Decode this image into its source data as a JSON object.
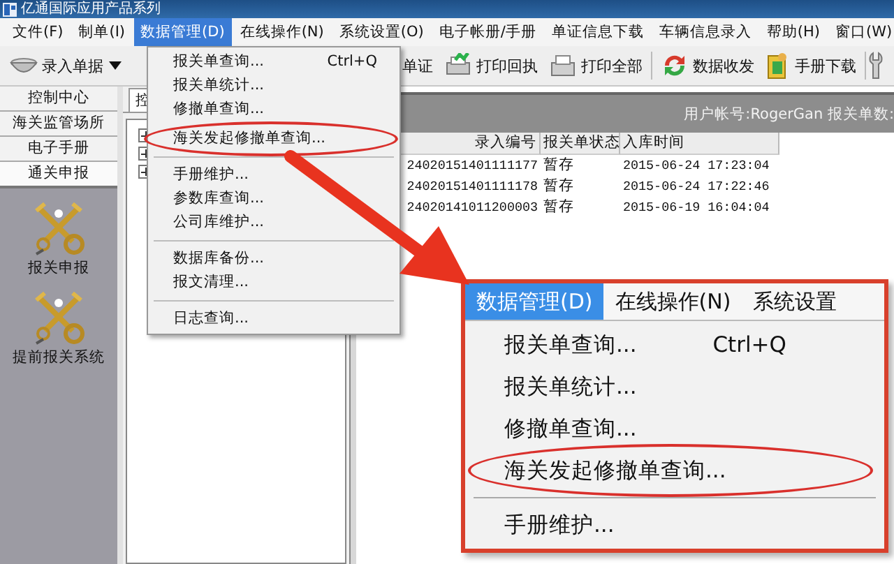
{
  "window": {
    "title": "亿通国际应用产品系列"
  },
  "menu_bar": [
    {
      "label": "文件(F)",
      "selected": false
    },
    {
      "label": "制单(I)",
      "selected": false
    },
    {
      "label": "数据管理(D)",
      "selected": true
    },
    {
      "label": "在线操作(N)",
      "selected": false
    },
    {
      "label": "系统设置(O)",
      "selected": false
    },
    {
      "label": "电子帐册/手册",
      "selected": false
    },
    {
      "label": "单证信息下载",
      "selected": false
    },
    {
      "label": "车辆信息录入",
      "selected": false
    },
    {
      "label": "帮助(H)",
      "selected": false
    },
    {
      "label": "窗口(W)",
      "selected": false
    }
  ],
  "toolbar": {
    "left": [
      {
        "label": "录入单据"
      }
    ],
    "right": [
      {
        "label": "单证"
      },
      {
        "label": "打印回执"
      },
      {
        "label": "打印全部"
      },
      {
        "label": "数据收发"
      },
      {
        "label": "手册下载"
      }
    ]
  },
  "sidebar": {
    "items": [
      {
        "label": "控制中心",
        "selected": false
      },
      {
        "label": "海关监管场所",
        "selected": false
      },
      {
        "label": "电子手册",
        "selected": false
      },
      {
        "label": "通关申报",
        "selected": true
      }
    ],
    "launchers": [
      {
        "label": "报关申报"
      },
      {
        "label": "提前报关系统"
      }
    ]
  },
  "tabs": [
    {
      "label": "控",
      "selected": true
    }
  ],
  "tree": {
    "nodes": [
      {
        "expanded": false
      },
      {
        "expanded": false
      },
      {
        "expanded": false
      }
    ]
  },
  "user_info": "用户帐号:RogerGan 报关单数:",
  "table": {
    "columns": [
      "录入编号",
      "报关单状态",
      "入库时间"
    ],
    "rows": [
      [
        "24020151401111177",
        "暂存",
        "2015-06-24 17:23:04"
      ],
      [
        "24020151401111178",
        "暂存",
        "2015-06-24 17:22:46"
      ],
      [
        "24020141011200003",
        "暂存",
        "2015-06-19 16:04:04"
      ]
    ]
  },
  "dropdown": [
    {
      "kind": "item",
      "label": "报关单查询...",
      "shortcut": "Ctrl+Q"
    },
    {
      "kind": "item",
      "label": "报关单统计..."
    },
    {
      "kind": "item",
      "label": "修撤单查询..."
    },
    {
      "kind": "item",
      "label": "海关发起修撤单查询...",
      "circled": true
    },
    {
      "kind": "separator"
    },
    {
      "kind": "item",
      "label": "手册维护..."
    },
    {
      "kind": "item",
      "label": "参数库查询..."
    },
    {
      "kind": "item",
      "label": "公司库维护..."
    },
    {
      "kind": "separator"
    },
    {
      "kind": "item",
      "label": "数据库备份..."
    },
    {
      "kind": "item",
      "label": "报文清理..."
    },
    {
      "kind": "separator"
    },
    {
      "kind": "item",
      "label": "日志查询..."
    }
  ],
  "zoom_inset": {
    "menu_bar": [
      {
        "label": "数据管理(D)",
        "selected": true
      },
      {
        "label": "在线操作(N)",
        "selected": false
      },
      {
        "label": "系统设置",
        "selected": false
      }
    ],
    "dropdown": [
      {
        "kind": "item",
        "label": "报关单查询...",
        "shortcut": "Ctrl+Q"
      },
      {
        "kind": "item",
        "label": "报关单统计..."
      },
      {
        "kind": "item",
        "label": "修撤单查询..."
      },
      {
        "kind": "item",
        "label": "海关发起修撤单查询...",
        "circled": true
      },
      {
        "kind": "separator"
      },
      {
        "kind": "item",
        "label": "手册维护..."
      }
    ]
  }
}
